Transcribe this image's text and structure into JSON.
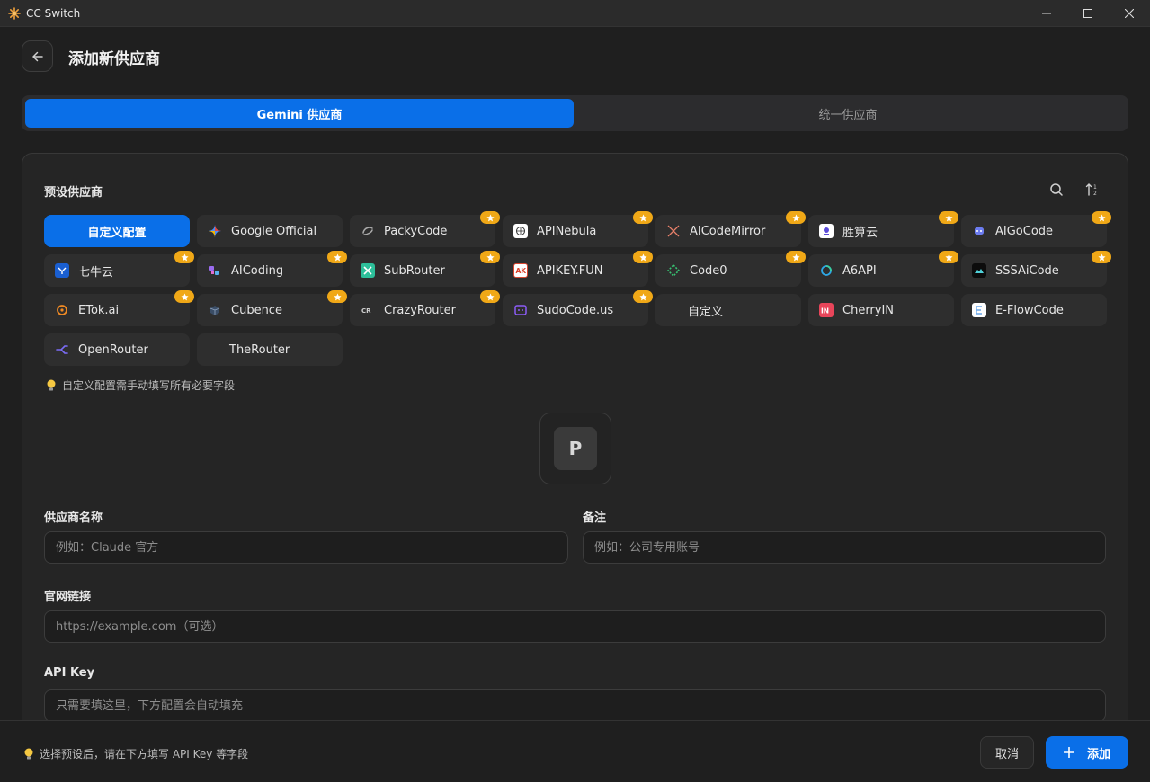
{
  "window": {
    "title": "CC Switch"
  },
  "header": {
    "title": "添加新供应商"
  },
  "tabs": [
    {
      "label": "Gemini 供应商",
      "active": true
    },
    {
      "label": "统一供应商",
      "active": false
    }
  ],
  "presets": {
    "title": "预设供应商",
    "items": [
      {
        "label": "自定义配置",
        "selected": true
      },
      {
        "label": "Google Official",
        "icon": "google-icon"
      },
      {
        "label": "PackyCode",
        "icon": "packycode-icon",
        "star": true
      },
      {
        "label": "APINebula",
        "icon": "apinebula-icon",
        "star": true
      },
      {
        "label": "AICodeMirror",
        "icon": "aicodemirror-icon",
        "star": true
      },
      {
        "label": "胜算云",
        "icon": "shengsuanyun-icon",
        "star": true
      },
      {
        "label": "AIGoCode",
        "icon": "aigocode-icon",
        "star": true
      },
      {
        "label": "七牛云",
        "icon": "qiniu-icon",
        "star": true
      },
      {
        "label": "AICoding",
        "icon": "aicoding-icon",
        "star": true
      },
      {
        "label": "SubRouter",
        "icon": "subrouter-icon",
        "star": true
      },
      {
        "label": "APIKEY.FUN",
        "icon": "apikeyfun-icon",
        "star": true
      },
      {
        "label": "Code0",
        "icon": "code0-icon",
        "star": true
      },
      {
        "label": "A6API",
        "icon": "a6api-icon",
        "star": true
      },
      {
        "label": "SSSAiCode",
        "icon": "sssaicode-icon",
        "star": true
      },
      {
        "label": "ETok.ai",
        "icon": "etok-icon",
        "star": true
      },
      {
        "label": "Cubence",
        "icon": "cubence-icon",
        "star": true
      },
      {
        "label": "CrazyRouter",
        "icon": "crazyrouter-icon",
        "star": true
      },
      {
        "label": "SudoCode.us",
        "icon": "sudocode-icon",
        "star": true
      },
      {
        "label": "自定义"
      },
      {
        "label": "CherryIN",
        "icon": "cherryin-icon"
      },
      {
        "label": "E-FlowCode",
        "icon": "eflowcode-icon"
      },
      {
        "label": "OpenRouter",
        "icon": "openrouter-icon"
      },
      {
        "label": "TheRouter"
      }
    ],
    "hint": "自定义配置需手动填写所有必要字段"
  },
  "logo": {
    "letter": "P"
  },
  "form": {
    "name_label": "供应商名称",
    "name_placeholder": "例如：Claude 官方",
    "note_label": "备注",
    "note_placeholder": "例如：公司专用账号",
    "website_label": "官网链接",
    "website_placeholder": "https://example.com（可选）",
    "apikey_label": "API Key",
    "apikey_placeholder": "只需要填这里，下方配置会自动填充"
  },
  "footer": {
    "hint": "选择预设后，请在下方填写 API Key 等字段",
    "cancel_label": "取消",
    "add_label": "添加"
  },
  "colors": {
    "accent": "#0a6fe8",
    "star": "#f0a817",
    "background": "#1f1f1f",
    "card": "#252525",
    "chip": "#2e2e2e"
  }
}
